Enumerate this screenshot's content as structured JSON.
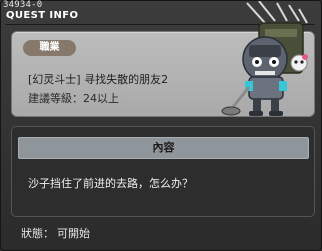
{
  "window": {
    "quest_id": "34934-0",
    "title": "QUEST INFO"
  },
  "quest": {
    "job_tag": "職業",
    "name": "[幻灵斗士] 寻找失散的朋友2",
    "required_level": "建議等級：24以上"
  },
  "content": {
    "header": "內容",
    "text": "沙子挡住了前进的去路，怎么办？"
  },
  "status": {
    "label": "狀態：",
    "value": "可開始"
  },
  "icons": {
    "npc": "robot-npc-icon"
  }
}
